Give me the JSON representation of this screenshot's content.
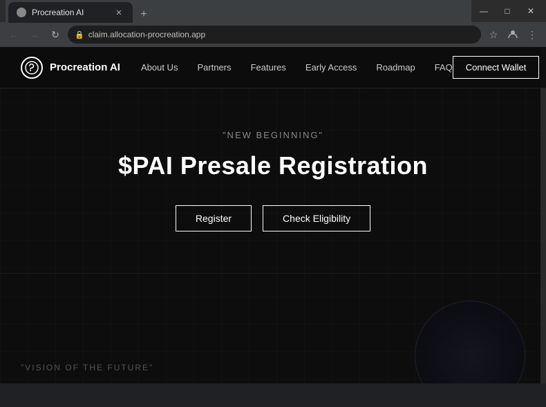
{
  "browser": {
    "tab": {
      "favicon_alt": "favicon",
      "title": "Procreation AI",
      "close_symbol": "✕",
      "new_tab_symbol": "+"
    },
    "window_controls": {
      "minimize": "—",
      "maximize": "□",
      "close": "✕"
    },
    "nav": {
      "back_symbol": "←",
      "forward_symbol": "→",
      "refresh_symbol": "↻"
    },
    "address": "claim.allocation-procreation.app",
    "toolbar_icons": [
      "☆",
      "⊙",
      "⋮"
    ]
  },
  "navbar": {
    "logo": {
      "icon_text": "P",
      "brand_name": "Procreation AI"
    },
    "links": [
      {
        "label": "About Us"
      },
      {
        "label": "Partners"
      },
      {
        "label": "Features"
      },
      {
        "label": "Early Access"
      },
      {
        "label": "Roadmap"
      },
      {
        "label": "FAQ"
      }
    ],
    "cta": {
      "label": "Connect Wallet"
    }
  },
  "hero": {
    "subtitle": "\"NEW BEGINNING\"",
    "title": "$PAI Presale Registration",
    "buttons": {
      "register": "Register",
      "eligibility": "Check Eligibility"
    }
  },
  "footer": {
    "vision_text": "\"VISION OF THE FUTURE\""
  }
}
